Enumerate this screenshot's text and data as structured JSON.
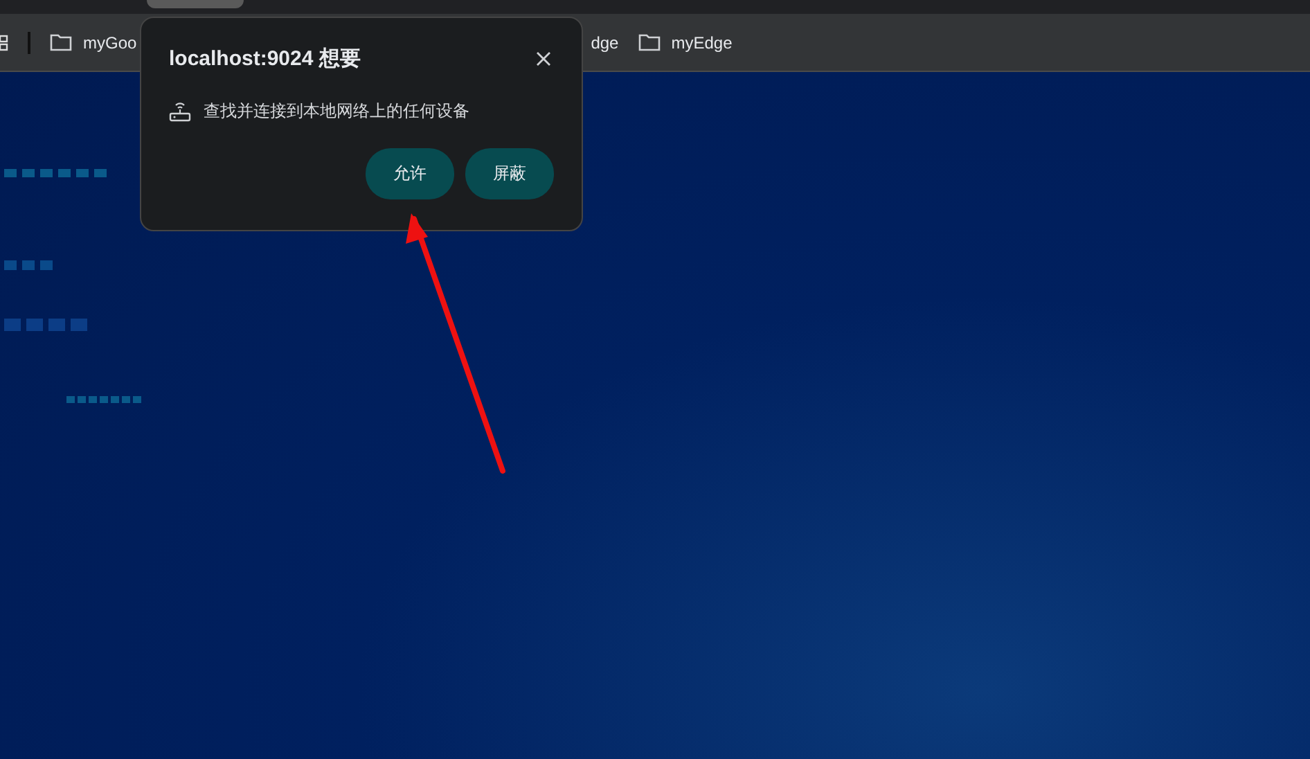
{
  "bookmarks_bar": {
    "items": [
      {
        "label": "myGoo"
      },
      {
        "label": "dge"
      },
      {
        "label": "myEdge"
      }
    ]
  },
  "permission_popup": {
    "title": "localhost:9024 想要",
    "permission": "查找并连接到本地网络上的任何设备",
    "buttons": [
      {
        "label": "允许"
      },
      {
        "label": "屏蔽"
      }
    ]
  }
}
